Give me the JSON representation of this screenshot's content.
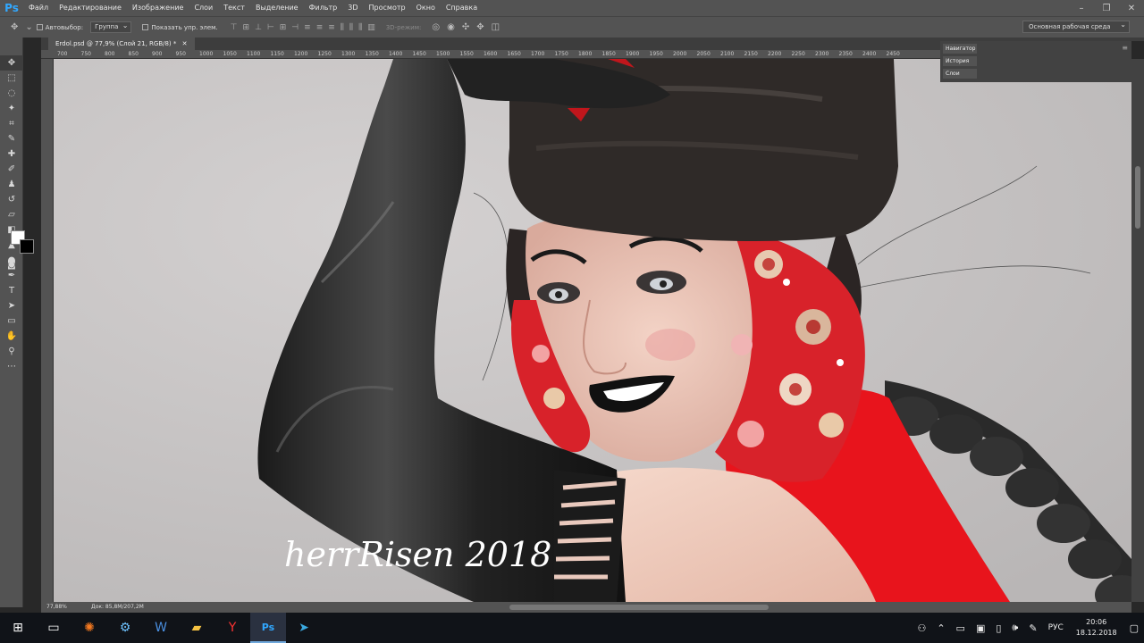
{
  "app": {
    "logo": "Ps"
  },
  "menu": [
    "Файл",
    "Редактирование",
    "Изображение",
    "Слои",
    "Текст",
    "Выделение",
    "Фильтр",
    "3D",
    "Просмотр",
    "Окно",
    "Справка"
  ],
  "options": {
    "autoselect_label": "Автовыбор:",
    "autoselect_value": "Группа",
    "show_controls_label": "Показать упр. элем.",
    "mode3d_label": "3D-режим:",
    "workspace": "Основная рабочая среда"
  },
  "document": {
    "tab_title": "Erdol.psd @ 77,9% (Слой 21, RGB/8) *"
  },
  "ruler_ticks": [
    "700",
    "750",
    "800",
    "850",
    "900",
    "950",
    "1000",
    "1050",
    "1100",
    "1150",
    "1200",
    "1250",
    "1300",
    "1350",
    "1400",
    "1450",
    "1500",
    "1550",
    "1600",
    "1650",
    "1700",
    "1750",
    "1800",
    "1850",
    "1900",
    "1950",
    "2000",
    "2050",
    "2100",
    "2150",
    "2200",
    "2250",
    "2300",
    "2350",
    "2400",
    "2450"
  ],
  "panels": [
    "Навигатор",
    "История",
    "Слои"
  ],
  "status": {
    "zoom": "77,88%",
    "doc": "Док: 85,8M/207,2M"
  },
  "artwork": {
    "signature": "herrRisen 2018"
  },
  "taskbar": {
    "icons": [
      "windows-icon",
      "task-view-icon",
      "avast-icon",
      "settings-icon",
      "word-icon",
      "explorer-icon",
      "yandex-icon",
      "photoshop-icon",
      "telegram-icon"
    ],
    "language": "РУС",
    "time": "20:06",
    "date": "18.12.2018"
  },
  "colors": {
    "ps_blue": "#31a8ff",
    "scarf_red": "#e8141c",
    "canvas_bg": "#c9c6c6"
  }
}
